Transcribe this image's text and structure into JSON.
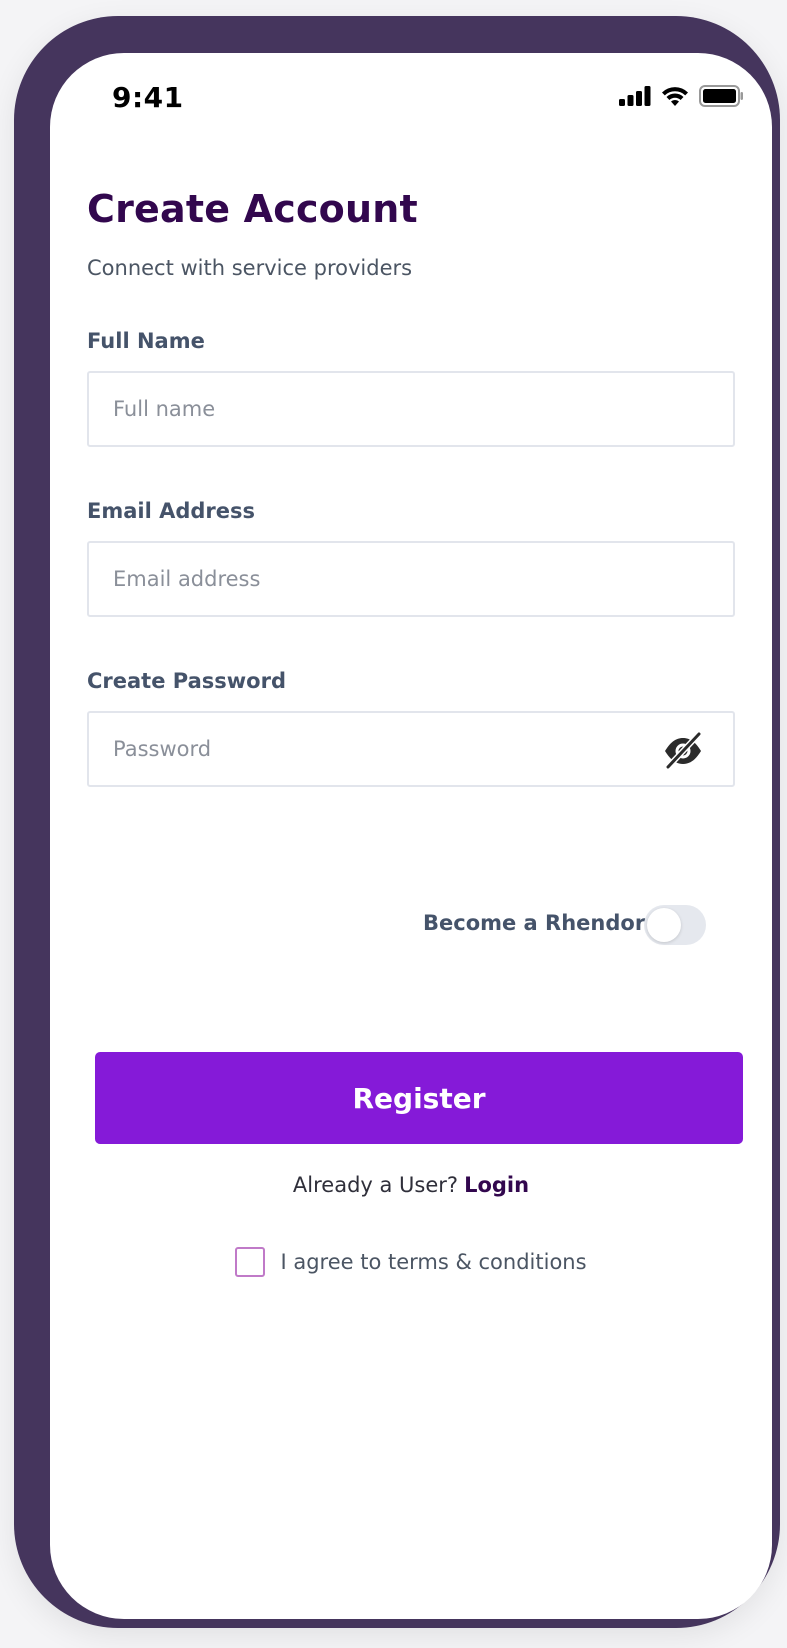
{
  "status_bar": {
    "time": "9:41",
    "icons": [
      "cellular-signal-icon",
      "wifi-icon",
      "battery-icon"
    ]
  },
  "header": {
    "title": "Create Account",
    "subtitle": "Connect with service providers"
  },
  "form": {
    "full_name": {
      "label": "Full Name",
      "placeholder": "Full name",
      "value": ""
    },
    "email": {
      "label": "Email Address",
      "placeholder": "Email address",
      "value": ""
    },
    "password": {
      "label": "Create Password",
      "placeholder": "Password",
      "value": "",
      "visibility_icon": "eye-off-icon"
    }
  },
  "vendor_toggle": {
    "label": "Become a Rhendor",
    "enabled": false
  },
  "register_button": {
    "label": "Register"
  },
  "login_prompt": {
    "text": "Already a User?",
    "link_label": "Login"
  },
  "terms": {
    "label": "I agree to terms & conditions",
    "checked": false
  },
  "colors": {
    "device_frame": "#45355d",
    "title": "#32074e",
    "primary_button": "#851ad8",
    "checkbox_border": "#c07ac8"
  }
}
